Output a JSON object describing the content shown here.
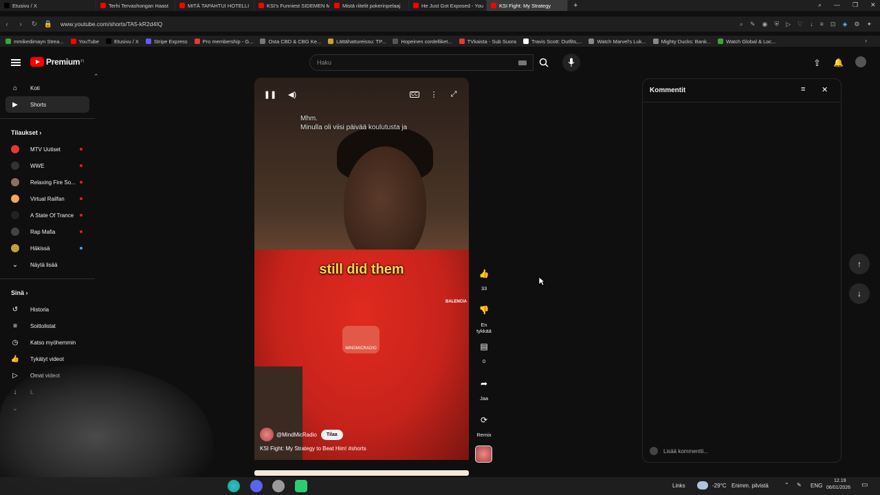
{
  "browser": {
    "tabs": [
      {
        "label": "Etusivu / X",
        "color": "#000000",
        "active": false
      },
      {
        "label": "Terhi Tervashongan Haast",
        "color": "#ff0000",
        "active": false
      },
      {
        "label": "MITÄ TAPAHTUI HOTELLI",
        "color": "#ff0000",
        "active": false
      },
      {
        "label": "KSI's Funniest SIDEMEN M",
        "color": "#ff0000",
        "active": false
      },
      {
        "label": "Mistä riitelit pokerinpelaaj",
        "color": "#ff0000",
        "active": false
      },
      {
        "label": "He Just Got Exposed - You",
        "color": "#ff0000",
        "active": false
      },
      {
        "label": "KSI Fight: My Strategy",
        "color": "#ff0000",
        "active": true
      }
    ],
    "new_tab_label": "+",
    "url": "www.youtube.com/shorts/TA5-kR2d4IQ",
    "bookmarks": [
      {
        "label": "mmikedimayn Strea...",
        "color": "#3ba53b"
      },
      {
        "label": "YouTube",
        "color": "#ff0000"
      },
      {
        "label": "Etusivu / X",
        "color": "#000000"
      },
      {
        "label": "Stripe Express",
        "color": "#635bff"
      },
      {
        "label": "Pro membership - G...",
        "color": "#e53935"
      },
      {
        "label": "Osta CBD & CBG Ke...",
        "color": "#777777"
      },
      {
        "label": "Lättähattureissu: TP...",
        "color": "#c9a227"
      },
      {
        "label": "Hopeinen cordelliket...",
        "color": "#555555"
      },
      {
        "label": "TVkaista - Sub Suora",
        "color": "#e53935"
      },
      {
        "label": "Travis Scott: Outfits,...",
        "color": "#ffffff"
      },
      {
        "label": "Watch Marvel's Luk...",
        "color": "#888888"
      },
      {
        "label": "Mighty Ducks: Bank...",
        "color": "#888888"
      },
      {
        "label": "Watch Global & Loc...",
        "color": "#3ba53b"
      }
    ]
  },
  "header": {
    "logo_text": "Premium",
    "logo_sup": "FI",
    "search_placeholder": "Haku"
  },
  "sidebar": {
    "main": [
      {
        "label": "Koti",
        "icon": "home-icon",
        "glyph": "⌂"
      },
      {
        "label": "Shorts",
        "icon": "shorts-icon",
        "glyph": "▶"
      }
    ],
    "subs_heading": "Tilaukset",
    "subs": [
      {
        "label": "MTV Uutiset",
        "color": "#e53935"
      },
      {
        "label": "WWE",
        "color": "#333333"
      },
      {
        "label": "Relaxing Fire So...",
        "color": "#8d6e63"
      },
      {
        "label": "Virtual Railfan",
        "color": "#f4a460"
      },
      {
        "label": "A State Of Trance",
        "color": "#222222"
      },
      {
        "label": "Rap Mafia",
        "color": "#444444"
      },
      {
        "label": "Häkissä",
        "color": "#c0a040"
      }
    ],
    "show_more": "Näytä lisää",
    "you_heading": "Sinä",
    "you": [
      {
        "label": "Historia",
        "glyph": "↺"
      },
      {
        "label": "Soittolistat",
        "glyph": "≡"
      },
      {
        "label": "Katso myöhemmin",
        "glyph": "◷"
      },
      {
        "label": "Tykätyt videot",
        "glyph": "👍"
      },
      {
        "label": "Omat videot",
        "glyph": "▷"
      },
      {
        "label": "L",
        "glyph": "↓"
      }
    ]
  },
  "video": {
    "subtitle_line1": "Mhm.",
    "subtitle_line2": "Minulla oli viisi päivää koulutusta ja",
    "caption": "still did them",
    "brand": "BALENCIA",
    "watermark": "MINDMICRADIO",
    "channel": "@MindMicRadio",
    "subscribe_label": "Tilaa",
    "title": "KSI Fight: My Strategy to Beat Him! #shorts"
  },
  "actions": {
    "like_count": "33",
    "dislike_label": "En tykkää",
    "comments_count": "0",
    "share_label": "Jaa",
    "remix_label": "Remix"
  },
  "comments": {
    "title": "Kommentit",
    "add_placeholder": "Lisää kommentti..."
  },
  "taskbar": {
    "links_label": "Links",
    "temperature": "-29°C",
    "weather": "Enimm. pilvistä",
    "lang": "ENG",
    "time": "12.19",
    "date": "06/01/2026"
  }
}
